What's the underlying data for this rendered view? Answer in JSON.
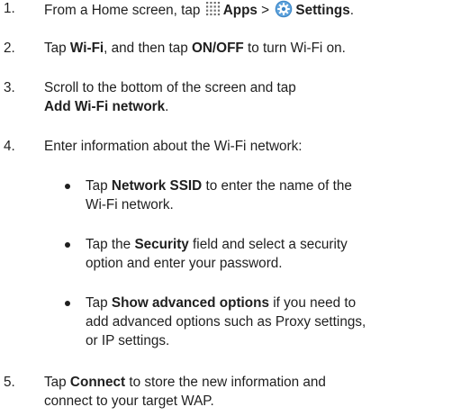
{
  "steps": [
    {
      "number": "1.",
      "line1": {
        "a": "From a Home screen, tap ",
        "apps": "Apps",
        "sep": " > ",
        "settings": "Settings",
        "end": "."
      }
    },
    {
      "number": "2.",
      "line1": {
        "a": "Tap ",
        "wifi": "Wi-Fi",
        "b": ", and then tap ",
        "onoff": "ON/OFF",
        "c": " to turn Wi-Fi on."
      }
    },
    {
      "number": "3.",
      "line1": "Scroll to the bottom of the screen and tap",
      "line2": "Add Wi-Fi network",
      "line2_end": "."
    },
    {
      "number": "4.",
      "line1": "Enter information about the Wi-Fi network:"
    },
    {
      "number": "5.",
      "line1": {
        "a": "Tap ",
        "connect": "Connect",
        "b": " to store the new information and"
      },
      "line2": "connect to your target WAP."
    }
  ],
  "bullets": [
    {
      "line1": {
        "a": "Tap ",
        "bold": "Network SSID",
        "b": " to enter the name of the"
      },
      "line2": "Wi-Fi network."
    },
    {
      "line1": {
        "a": "Tap the ",
        "bold": "Security",
        "b": " field and select a security"
      },
      "line2": "option and enter your password."
    },
    {
      "line1": {
        "a": "Tap ",
        "bold": "Show advanced options",
        "b": " if you need to"
      },
      "line2": "add advanced options such as Proxy settings,",
      "line3": "or IP settings."
    }
  ],
  "icons": {
    "apps": "apps-grid-icon",
    "settings": "settings-gear-icon",
    "settings_color": "#3d86c6"
  }
}
